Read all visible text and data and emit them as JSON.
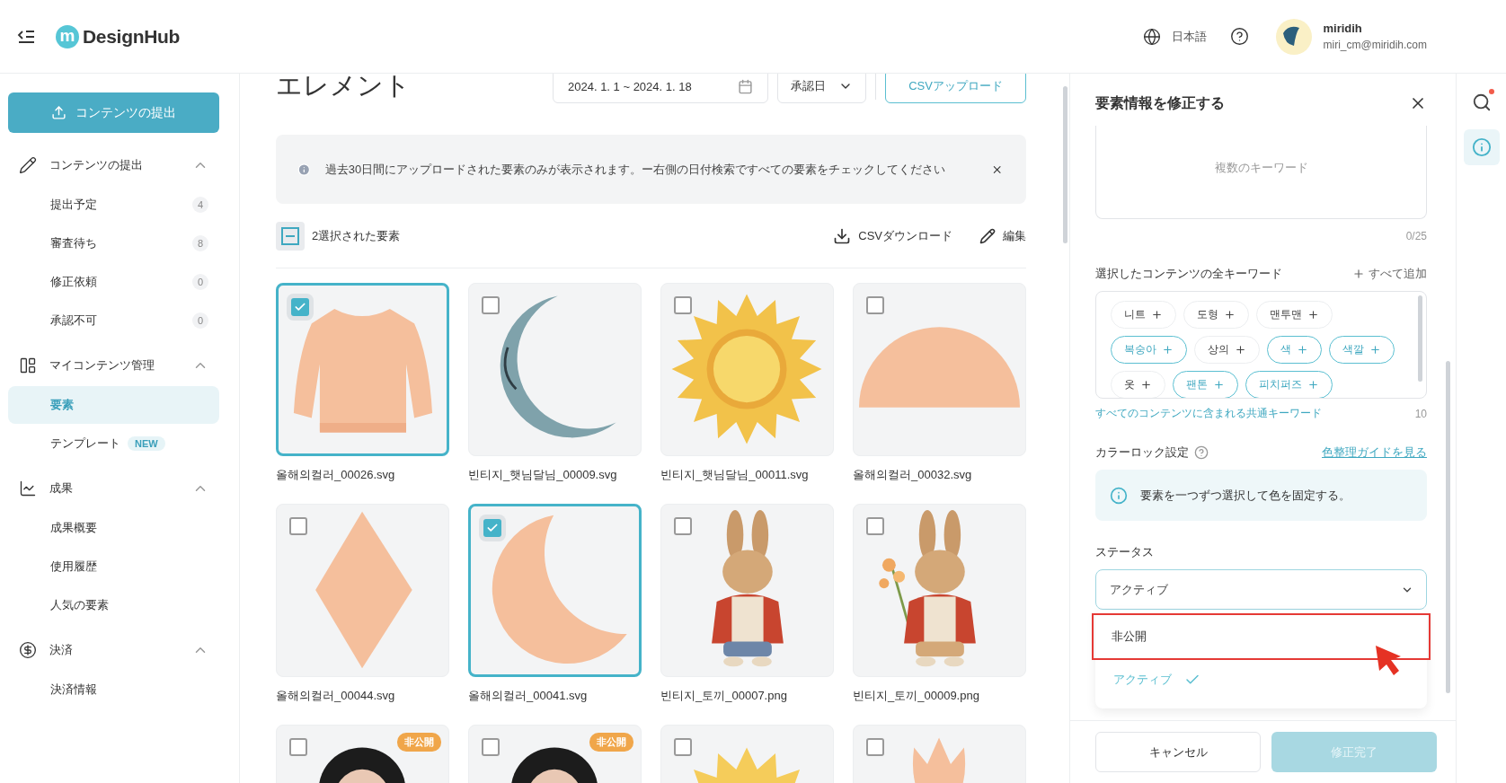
{
  "header": {
    "logo_mark": "m",
    "logo_text": "DesignHub",
    "language": "日本語",
    "user": {
      "name": "miridih",
      "email": "miri_cm@miridih.com"
    }
  },
  "sidebar": {
    "upload_button": "コンテンツの提出",
    "sections": [
      {
        "title": "コンテンツの提出",
        "expanded": true,
        "items": [
          {
            "label": "提出予定",
            "count": "4",
            "selected": false
          },
          {
            "label": "審査待ち",
            "count": "8",
            "selected": false
          },
          {
            "label": "修正依頼",
            "count": "0",
            "selected": false
          },
          {
            "label": "承認不可",
            "count": "0",
            "selected": false
          }
        ]
      },
      {
        "title": "マイコンテンツ管理",
        "expanded": true,
        "items": [
          {
            "label": "要素",
            "selected": true
          },
          {
            "label": "テンプレート",
            "badge": "NEW",
            "selected": false
          }
        ]
      },
      {
        "title": "成果",
        "expanded": true,
        "items": [
          {
            "label": "成果概要",
            "selected": false
          },
          {
            "label": "使用履歴",
            "selected": false
          },
          {
            "label": "人気の要素",
            "selected": false
          }
        ]
      },
      {
        "title": "決済",
        "expanded": true,
        "items": [
          {
            "label": "決済情報",
            "selected": false
          }
        ]
      }
    ]
  },
  "main": {
    "title": "エレメント",
    "date_range": "2024. 1. 1 ~ 2024. 1. 18",
    "sort": "承認日",
    "upload_csv": "CSVアップロード",
    "notice": "過去30日間にアップロードされた要素のみが表示されます。ー右側の日付検索ですべての要素をチェックしてください",
    "selection": {
      "label": "2選択された要素",
      "partial": true
    },
    "download_csv": "CSVダウンロード",
    "edit": "編集",
    "cards": [
      {
        "kind": "sweater",
        "file": "올해의컬러_00026.svg",
        "checked": true
      },
      {
        "kind": "moon",
        "file": "빈티지_햇님달님_00009.svg",
        "checked": false
      },
      {
        "kind": "sun",
        "file": "빈티지_햇님달님_00011.svg",
        "checked": false
      },
      {
        "kind": "semicircle",
        "file": "올해의컬러_00032.svg",
        "checked": false
      },
      {
        "kind": "diamond",
        "file": "올해의컬러_00044.svg",
        "checked": false
      },
      {
        "kind": "crescent",
        "file": "올해의컬러_00041.svg",
        "checked": true
      },
      {
        "kind": "rabbit",
        "file": "빈티지_토끼_00007.png",
        "checked": false
      },
      {
        "kind": "rabbit_flowers",
        "file": "빈티지_토끼_00009.png",
        "checked": false
      },
      {
        "kind": "person",
        "badge": "非公開",
        "checked": false
      },
      {
        "kind": "person",
        "badge": "非公開",
        "checked": false
      },
      {
        "kind": "sun_rays",
        "checked": false
      },
      {
        "kind": "tulip",
        "checked": false
      }
    ]
  },
  "panel": {
    "title": "要素情報を修正する",
    "keywords_placeholder": "複数のキーワード",
    "keywords_count": "0/25",
    "all_keywords_label": "選択したコンテンツの全キーワード",
    "add_all": "すべて追加",
    "chips": [
      {
        "text": "니트",
        "selected": false
      },
      {
        "text": "도형",
        "selected": false
      },
      {
        "text": "맨투맨",
        "selected": false
      },
      {
        "text": "복숭아",
        "selected": true
      },
      {
        "text": "상의",
        "selected": false
      },
      {
        "text": "색",
        "selected": true
      },
      {
        "text": "색깔",
        "selected": true
      },
      {
        "text": "옷",
        "selected": false
      },
      {
        "text": "팬톤",
        "selected": true
      },
      {
        "text": "피치퍼즈",
        "selected": true
      }
    ],
    "common_link": "すべてのコンテンツに含まれる共通キーワード",
    "common_count": "10",
    "color_lock_label": "カラーロック設定",
    "guide_link": "色整理ガイドを見る",
    "color_lock_info": "要素を一つずつ選択して色を固定する。",
    "status_label": "ステータス",
    "status_value": "アクティブ",
    "options": [
      {
        "text": "非公開",
        "selected": false,
        "highlighted": true
      },
      {
        "text": "アクティブ",
        "selected": true,
        "highlighted": false
      }
    ],
    "cancel": "キャンセル",
    "submit": "修正完了",
    "submit_disabled": true
  }
}
